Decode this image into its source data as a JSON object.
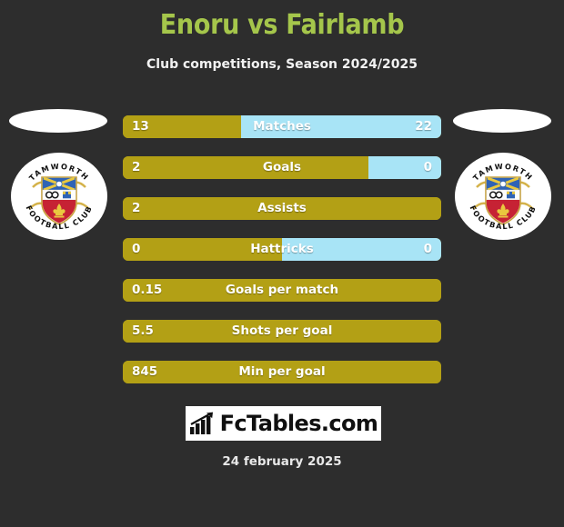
{
  "header": {
    "title": "Enoru vs Fairlamb",
    "subtitle": "Club competitions, Season 2024/2025"
  },
  "colors": {
    "background": "#2d2d2d",
    "title_green": "#a5c64b",
    "bar_home": "#b3a015",
    "bar_away": "#a8e4f6",
    "text_light": "#ffffff"
  },
  "teams": {
    "home": {
      "crest_name": "tamworth-football-club-crest",
      "crest_top_text": "TAMWORTH",
      "crest_bottom_text": "FOOTBALL CLUB"
    },
    "away": {
      "crest_name": "tamworth-football-club-crest",
      "crest_top_text": "TAMWORTH",
      "crest_bottom_text": "FOOTBALL CLUB"
    }
  },
  "stats": [
    {
      "label": "Matches",
      "home": "13",
      "away": "22",
      "home_pct": 37,
      "show_away": true
    },
    {
      "label": "Goals",
      "home": "2",
      "away": "0",
      "home_pct": 77,
      "show_away": true
    },
    {
      "label": "Assists",
      "home": "2",
      "away": "",
      "home_pct": 100,
      "show_away": false
    },
    {
      "label": "Hattricks",
      "home": "0",
      "away": "0",
      "home_pct": 50,
      "show_away": true
    },
    {
      "label": "Goals per match",
      "home": "0.15",
      "away": "",
      "home_pct": 100,
      "show_away": false
    },
    {
      "label": "Shots per goal",
      "home": "5.5",
      "away": "",
      "home_pct": 100,
      "show_away": false
    },
    {
      "label": "Min per goal",
      "home": "845",
      "away": "",
      "home_pct": 100,
      "show_away": false
    }
  ],
  "footer": {
    "logo_text": "FcTables.com",
    "logo_icon": "bar-chart-arrow-icon",
    "date": "24 february 2025"
  }
}
